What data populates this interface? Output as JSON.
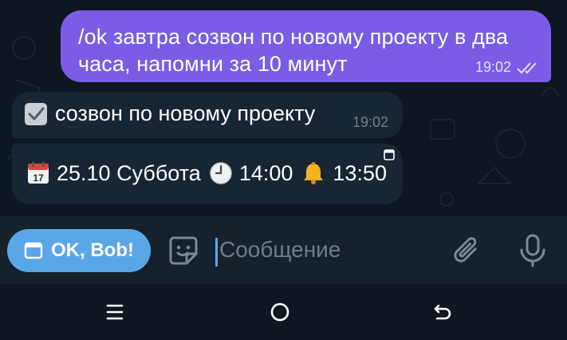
{
  "outgoing": {
    "text": "/ok завтра созвон по новому проекту в два часа, напомни за 10 минут",
    "time": "19:02"
  },
  "incoming": [
    {
      "title": "созвон по новому проекту",
      "time": "19:02",
      "icon": "check-box-icon"
    },
    {
      "date_emoji": "calendar-icon",
      "date": "25.10 Суббота",
      "time_emoji": "clock-icon",
      "event_time": "14:00",
      "reminder_emoji": "bell-icon",
      "reminder_time": "13:50"
    }
  ],
  "composer": {
    "keyboard_button": "OK, Bob!",
    "placeholder": "Сообщение"
  },
  "colors": {
    "chat_bg": "#0e1621",
    "outgoing_bubble": "#7b5ce6",
    "incoming_bubble": "#182533",
    "accent": "#5aa7e8",
    "composer_bg": "#17212b"
  }
}
